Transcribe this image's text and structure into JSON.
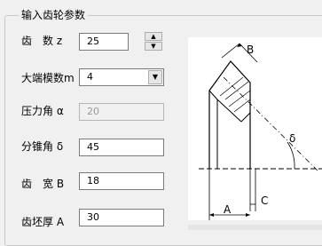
{
  "group": {
    "title": "输入齿轮参数"
  },
  "fields": {
    "teeth": {
      "label": "齿　数 z",
      "value": "25"
    },
    "module": {
      "label": "大端模数m",
      "value": "4"
    },
    "pressure": {
      "label": "压力角 α",
      "value": "20"
    },
    "cone": {
      "label": "分锥角 δ",
      "value": "45"
    },
    "width": {
      "label": "齿　宽 B",
      "value": "18"
    },
    "thickness": {
      "label": "齿坯厚 A",
      "value": "30"
    }
  },
  "diagram": {
    "label_b": "B",
    "label_delta": "δ",
    "label_c": "C",
    "label_a": "A"
  },
  "icons": {
    "spin_up": "chevron-up-icon",
    "spin_down": "chevron-down-icon",
    "dropdown": "chevron-down-icon"
  }
}
